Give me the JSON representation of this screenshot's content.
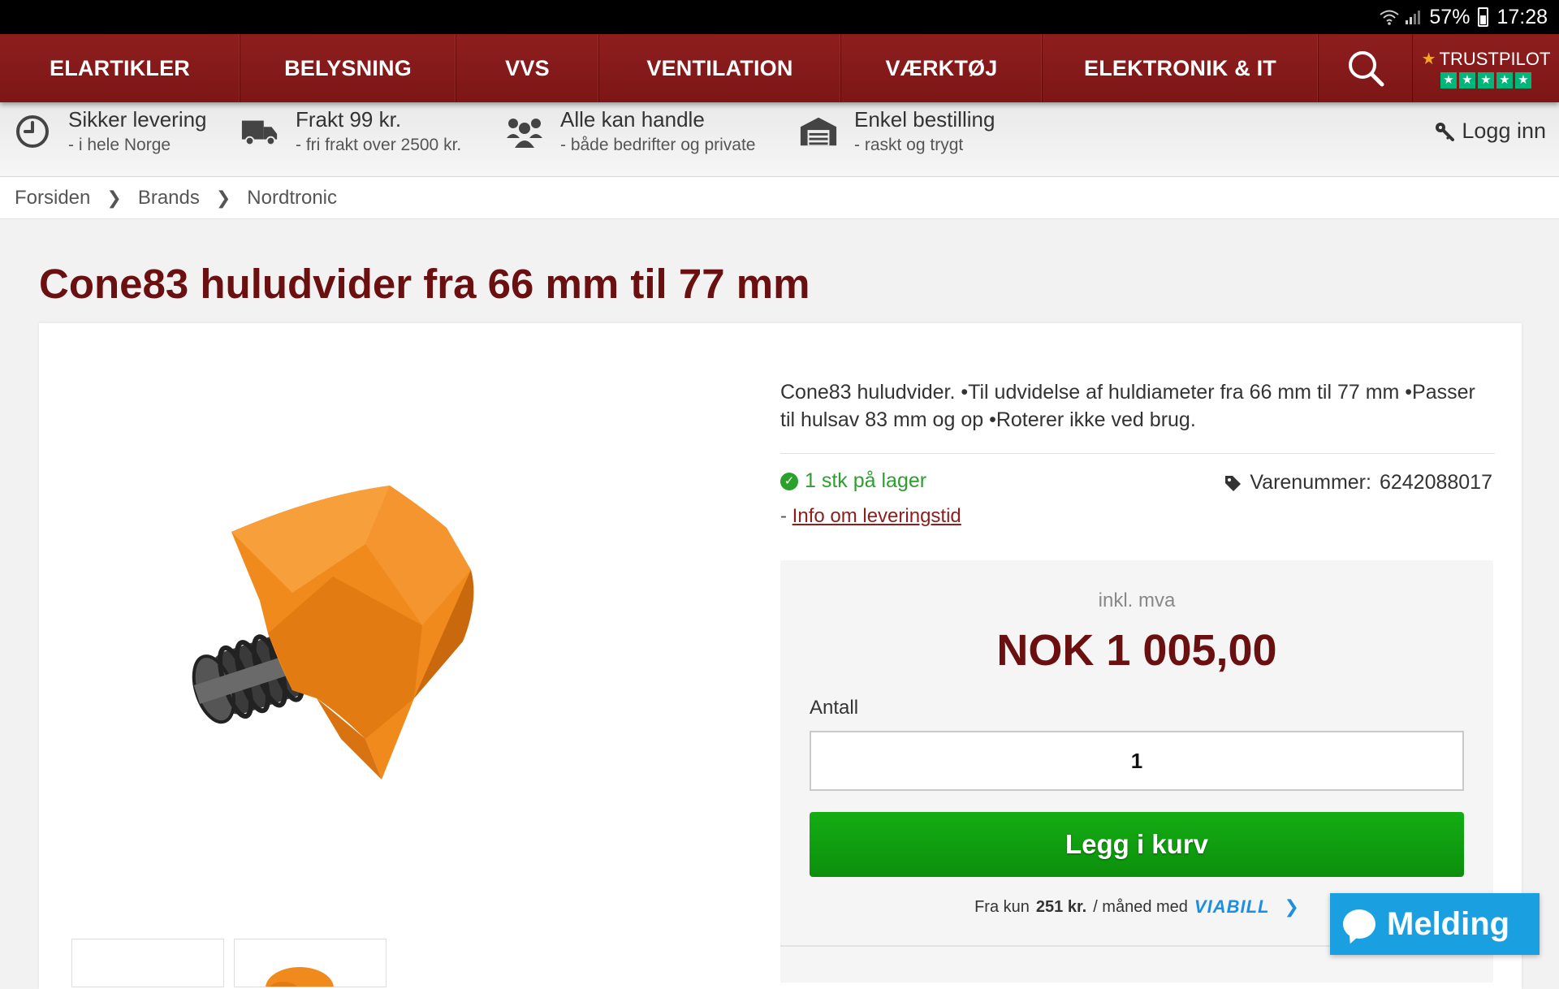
{
  "status_bar": {
    "battery": "57%",
    "time": "17:28"
  },
  "nav": {
    "items": [
      "ELARTIKLER",
      "BELYSNING",
      "VVS",
      "VENTILATION",
      "VÆRKTØJ",
      "ELEKTRONIK & IT"
    ],
    "trustpilot": "TRUSTPILOT"
  },
  "benefits": [
    {
      "title": "Sikker levering",
      "sub": "- i hele Norge",
      "icon": "clock-icon"
    },
    {
      "title": "Frakt 99 kr.",
      "sub": "- fri frakt over 2500 kr.",
      "icon": "truck-icon"
    },
    {
      "title": "Alle kan handle",
      "sub": "- både bedrifter og private",
      "icon": "people-icon"
    },
    {
      "title": "Enkel bestilling",
      "sub": "- raskt og trygt",
      "icon": "garage-icon"
    }
  ],
  "login_label": "Logg inn",
  "breadcrumb": [
    "Forsiden",
    "Brands",
    "Nordtronic"
  ],
  "product": {
    "title": "Cone83 huludvider fra 66 mm til 77 mm",
    "description": "Cone83 huludvider. •Til udvidelse af huldiameter fra 66 mm til 77 mm •Passer til hulsav 83 mm og op •Roterer ikke ved brug.",
    "stock": "1 stk på lager",
    "sku_label": "Varenummer:",
    "sku": "6242088017",
    "delivery_prefix": "-",
    "delivery_link": "Info om leveringstid",
    "vat_label": "inkl. mva",
    "price": "NOK 1 005,00",
    "quantity_label": "Antall",
    "quantity": "1",
    "add_to_cart": "Legg i kurv",
    "finance_prefix": "Fra kun",
    "finance_amount": "251 kr.",
    "finance_suffix": "/ måned med",
    "finance_provider": "VIABILL"
  },
  "chat_label": "Melding",
  "colors": {
    "brand": "#8e1e1e",
    "title": "#6b1010",
    "cart": "#12a312",
    "chat": "#1aa0e0",
    "stock": "#2e9e2e"
  }
}
